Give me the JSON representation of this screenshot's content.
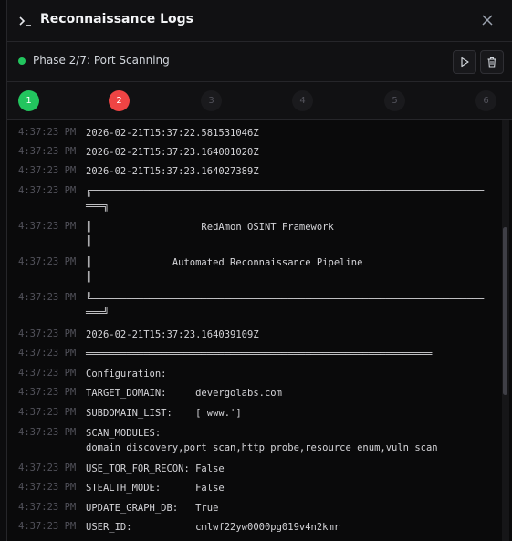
{
  "header": {
    "title": "Reconnaissance Logs"
  },
  "phase": {
    "label": "Phase 2/7: Port Scanning",
    "status_color": "#22c55e"
  },
  "steps": [
    {
      "label": "1",
      "state": "done"
    },
    {
      "label": "2",
      "state": "fail"
    },
    {
      "label": "3",
      "state": "pending"
    },
    {
      "label": "4",
      "state": "pending"
    },
    {
      "label": "5",
      "state": "pending"
    },
    {
      "label": "6",
      "state": "pending"
    }
  ],
  "log": {
    "timestamp": "4:37:23 PM",
    "lines": [
      "2026-02-21T15:37:22.581531046Z",
      "2026-02-21T15:37:23.164001020Z",
      "2026-02-21T15:37:23.164027389Z",
      "╔════════════════════════════════════════════════════════════════════\n═══╗",
      "║                   RedAmon OSINT Framework\n║",
      "║              Automated Reconnaissance Pipeline\n║",
      "╚════════════════════════════════════════════════════════════════════\n═══╝",
      "2026-02-21T15:37:23.164039109Z",
      "════════════════════════════════════════════════════════════",
      "Configuration:",
      "TARGET_DOMAIN:     devergolabs.com",
      "SUBDOMAIN_LIST:    ['www.']",
      "SCAN_MODULES:\ndomain_discovery,port_scan,http_probe,resource_enum,vuln_scan",
      "USE_TOR_FOR_RECON: False",
      "STEALTH_MODE:      False",
      "UPDATE_GRAPH_DB:   True",
      "USER_ID:           cmlwf22yw0000pg019v4n2kmr"
    ]
  },
  "colors": {
    "accent_success": "#22c55e",
    "accent_error": "#ef4444",
    "background": "#0a0a0b"
  }
}
